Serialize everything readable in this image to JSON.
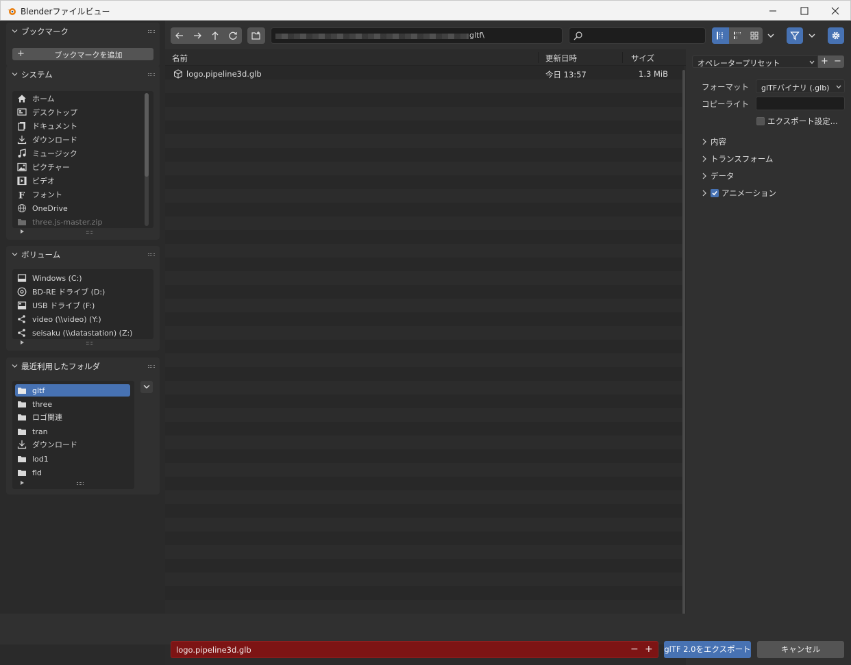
{
  "window": {
    "title": "Blenderファイルビュー"
  },
  "sidebar": {
    "bookmarks": {
      "title": "ブックマーク",
      "add_label": "ブックマークを追加"
    },
    "system": {
      "title": "システム",
      "items": [
        {
          "label": "ホーム",
          "icon": "home-icon"
        },
        {
          "label": "デスクトップ",
          "icon": "desktop-icon"
        },
        {
          "label": "ドキュメント",
          "icon": "documents-icon"
        },
        {
          "label": "ダウンロード",
          "icon": "download-icon"
        },
        {
          "label": "ミュージック",
          "icon": "music-icon"
        },
        {
          "label": "ピクチャー",
          "icon": "picture-icon"
        },
        {
          "label": "ビデオ",
          "icon": "video-icon"
        },
        {
          "label": "フォント",
          "icon": "font-icon"
        },
        {
          "label": "OneDrive",
          "icon": "network-icon"
        },
        {
          "label": "three.js-master.zip",
          "icon": "folder-icon"
        }
      ]
    },
    "volumes": {
      "title": "ボリューム",
      "items": [
        {
          "label": "Windows (C:)",
          "icon": "disk-icon"
        },
        {
          "label": "BD-RE ドライブ (D:)",
          "icon": "disc-icon"
        },
        {
          "label": "USB ドライブ (F:)",
          "icon": "usb-drive-icon"
        },
        {
          "label": "video (\\\\video) (Y:)",
          "icon": "network-drive-icon"
        },
        {
          "label": "seisaku (\\\\datastation) (Z:)",
          "icon": "network-drive-icon"
        }
      ]
    },
    "recent": {
      "title": "最近利用したフォルダ",
      "items": [
        {
          "label": "gltf",
          "icon": "folder-icon"
        },
        {
          "label": "three",
          "icon": "folder-icon"
        },
        {
          "label": "ロゴ関連",
          "icon": "folder-icon"
        },
        {
          "label": "tran",
          "icon": "folder-icon"
        },
        {
          "label": "ダウンロード",
          "icon": "download-icon"
        },
        {
          "label": "lod1",
          "icon": "folder-icon"
        },
        {
          "label": "fld",
          "icon": "folder-icon"
        }
      ]
    }
  },
  "toolbar": {
    "path_suffix": "gltf\\"
  },
  "file_list": {
    "columns": {
      "name": "名前",
      "date": "更新日時",
      "size": "サイズ"
    },
    "rows": [
      {
        "name": "logo.pipeline3d.glb",
        "date": "今日 13:57",
        "size": "1.3 MiB"
      }
    ]
  },
  "properties": {
    "preset": "オペレータープリセット",
    "format_label": "フォーマット",
    "format_value": "glTFバイナリ (.glb)",
    "copyright_label": "コピーライト",
    "copyright_value": "",
    "remember_label": "エクスポート設定...",
    "sections": [
      "内容",
      "トランスフォーム",
      "データ",
      "アニメーション"
    ]
  },
  "bottom": {
    "filename": "logo.pipeline3d.glb",
    "export_label": "glTF 2.0をエクスポート",
    "cancel_label": "キャンセル"
  },
  "colors": {
    "accent": "#4772b3",
    "filename_bg": "#7d1414"
  }
}
